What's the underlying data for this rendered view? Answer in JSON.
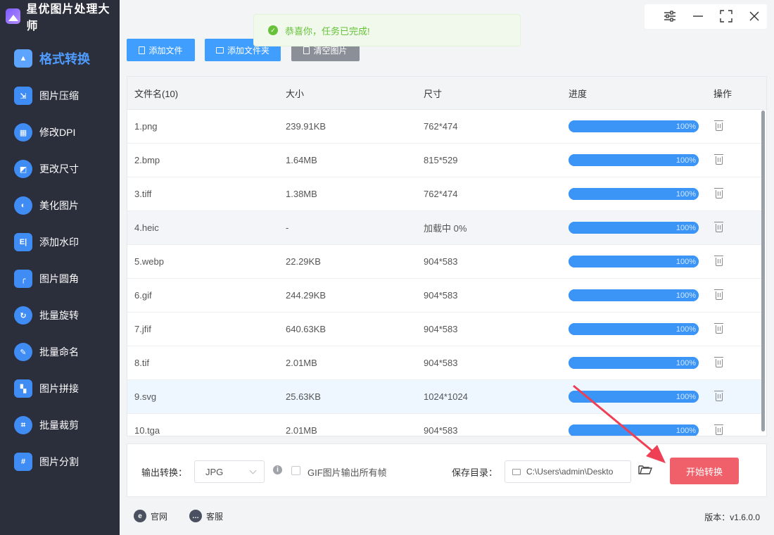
{
  "app": {
    "title": "星优图片处理大师"
  },
  "sidebar": {
    "items": [
      {
        "label": "格式转换",
        "icon": "image-convert-icon",
        "active": true
      },
      {
        "label": "图片压缩",
        "icon": "image-compress-icon"
      },
      {
        "label": "修改DPI",
        "icon": "dpi-icon"
      },
      {
        "label": "更改尺寸",
        "icon": "resize-icon"
      },
      {
        "label": "美化图片",
        "icon": "beautify-icon"
      },
      {
        "label": "添加水印",
        "icon": "watermark-icon"
      },
      {
        "label": "图片圆角",
        "icon": "round-corner-icon"
      },
      {
        "label": "批量旋转",
        "icon": "rotate-icon"
      },
      {
        "label": "批量命名",
        "icon": "rename-icon"
      },
      {
        "label": "图片拼接",
        "icon": "stitch-icon"
      },
      {
        "label": "批量裁剪",
        "icon": "crop-icon"
      },
      {
        "label": "图片分割",
        "icon": "split-icon"
      }
    ]
  },
  "toast": {
    "message": "恭喜你，任务已完成!"
  },
  "toolbar": {
    "add_file": "添加文件",
    "add_folder": "添加文件夹",
    "clear": "清空图片"
  },
  "table": {
    "headers": {
      "name": "文件名(10)",
      "size": "大小",
      "dimensions": "尺寸",
      "progress": "进度",
      "action": "操作"
    },
    "rows": [
      {
        "name": "1.png",
        "size": "239.91KB",
        "dimensions": "762*474",
        "progress": "100%"
      },
      {
        "name": "2.bmp",
        "size": "1.64MB",
        "dimensions": "815*529",
        "progress": "100%"
      },
      {
        "name": "3.tiff",
        "size": "1.38MB",
        "dimensions": "762*474",
        "progress": "100%"
      },
      {
        "name": "4.heic",
        "size": "-",
        "dimensions": "加载中 0%",
        "progress": "100%"
      },
      {
        "name": "5.webp",
        "size": "22.29KB",
        "dimensions": "904*583",
        "progress": "100%"
      },
      {
        "name": "6.gif",
        "size": "244.29KB",
        "dimensions": "904*583",
        "progress": "100%"
      },
      {
        "name": "7.jfif",
        "size": "640.63KB",
        "dimensions": "904*583",
        "progress": "100%"
      },
      {
        "name": "8.tif",
        "size": "2.01MB",
        "dimensions": "904*583",
        "progress": "100%"
      },
      {
        "name": "9.svg",
        "size": "25.63KB",
        "dimensions": "1024*1024",
        "progress": "100%"
      },
      {
        "name": "10.tga",
        "size": "2.01MB",
        "dimensions": "904*583",
        "progress": "100%"
      }
    ]
  },
  "settings": {
    "output_label": "输出转换：",
    "format_value": "JPG",
    "gif_option": "GIF图片输出所有帧",
    "save_label": "保存目录：",
    "save_path": "C:\\Users\\admin\\Deskto",
    "start_button": "开始转换"
  },
  "footer": {
    "website": "官网",
    "support": "客服",
    "version": "版本：v1.6.0.0"
  },
  "colors": {
    "sidebar_bg": "#2b2e3b",
    "accent": "#409eff",
    "start_button": "#f0606a",
    "progress": "#3b95f6",
    "success": "#67c23a"
  }
}
